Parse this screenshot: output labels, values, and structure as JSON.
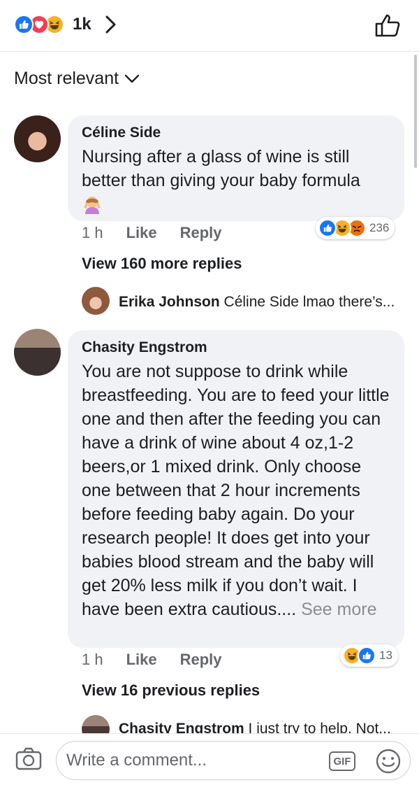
{
  "header": {
    "reaction_count": "1k",
    "reactions": [
      "like-icon",
      "love-icon",
      "haha-icon"
    ]
  },
  "sort": {
    "label": "Most relevant"
  },
  "comments": [
    {
      "author": "Céline Side",
      "text": "Nursing after a glass of wine is still better than giving your baby formula",
      "emoji": "woman-raising-hand-emoji",
      "time": "1 h",
      "like_label": "Like",
      "reply_label": "Reply",
      "reactions": [
        "like-icon",
        "haha-icon",
        "angry-icon"
      ],
      "reaction_count": "236",
      "view_replies": "View 160 more replies",
      "reply_preview": {
        "author": "Erika Johnson",
        "text": "Céline Side lmao there’s..."
      }
    },
    {
      "author": "Chasity Engstrom",
      "text": "You are not suppose to drink while breastfeeding. You are to feed your little one and then after the feeding you can have a drink of wine about 4 oz,1-2 beers,or 1 mixed drink. Only choose one between that 2 hour increments before feeding baby again. Do your research people! It does get into your babies blood stream and the baby will get 20% less milk if you don’t wait. I have been extra cautious.... ",
      "see_more": "See more",
      "time": "1 h",
      "like_label": "Like",
      "reply_label": "Reply",
      "reactions": [
        "haha-icon",
        "like-icon"
      ],
      "reaction_count": "13",
      "view_replies": "View 16 previous replies",
      "reply_preview": {
        "author": "Chasity Engstrom",
        "text": "I just try to help. Not..."
      }
    }
  ],
  "composer": {
    "placeholder": "Write a comment...",
    "gif_label": "GIF"
  },
  "colors": {
    "like_blue": "#1877f2",
    "love_red": "#f33e58",
    "haha_yellow": "#f7b125",
    "angry_orange": "#e9710f",
    "bubble_bg": "#f0f2f5",
    "muted_text": "#65676b"
  }
}
